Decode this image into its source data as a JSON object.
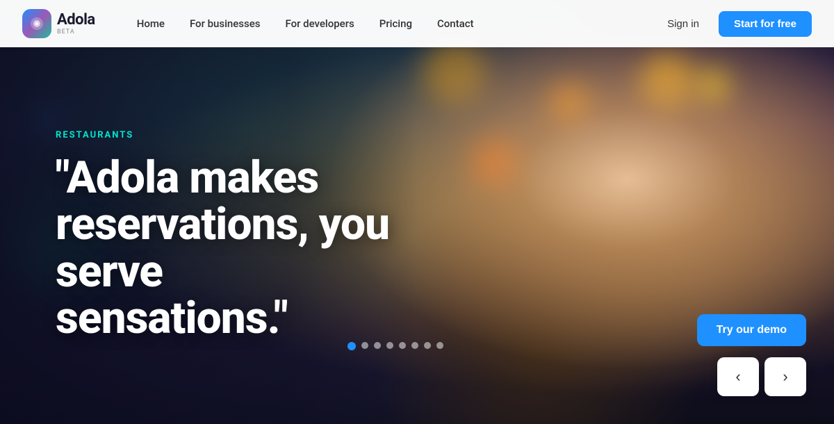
{
  "nav": {
    "logo": {
      "name": "Adola",
      "beta": "BETA"
    },
    "links": [
      {
        "label": "Home",
        "id": "home"
      },
      {
        "label": "For businesses",
        "id": "for-businesses"
      },
      {
        "label": "For developers",
        "id": "for-developers"
      },
      {
        "label": "Pricing",
        "id": "pricing"
      },
      {
        "label": "Contact",
        "id": "contact"
      }
    ],
    "signin_label": "Sign in",
    "start_label": "Start for free"
  },
  "hero": {
    "category": "RESTAURANTS",
    "headline": "\"Adola makes reservations, you serve sensations.\"",
    "demo_label": "Try our demo",
    "prev_label": "‹",
    "next_label": "›",
    "dots": [
      {
        "active": true
      },
      {
        "active": false
      },
      {
        "active": false
      },
      {
        "active": false
      },
      {
        "active": false
      },
      {
        "active": false
      },
      {
        "active": false
      },
      {
        "active": false
      }
    ]
  },
  "colors": {
    "accent_blue": "#1e90ff",
    "accent_teal": "#00e5cc"
  }
}
